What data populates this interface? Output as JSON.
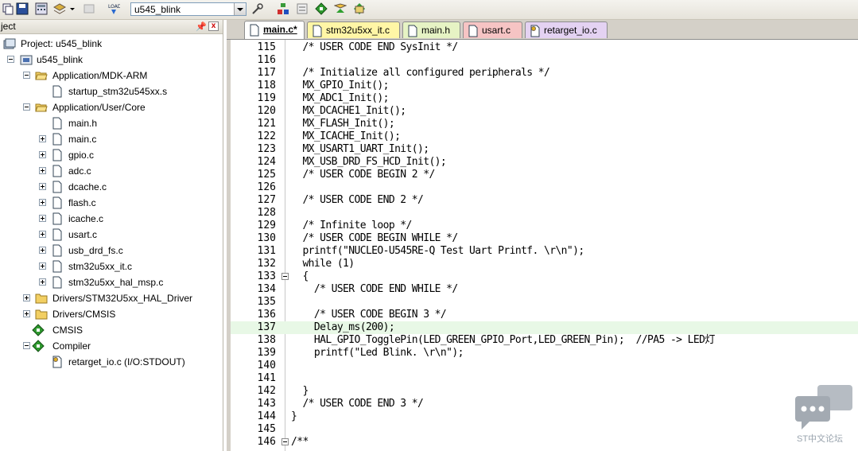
{
  "toolbar": {
    "target_select": {
      "value": "u545_blink"
    },
    "icons": [
      "copy-icon",
      "save-all-icon",
      "stack-icon",
      "dropdown-arrow-icon",
      "disabled-icon",
      "load-icon",
      "target-options-icon",
      "manage-components-icon",
      "window-icon",
      "pack-installer-icon",
      "select-pack-icon",
      "run-icon"
    ]
  },
  "project_panel": {
    "title": "ject",
    "tree": [
      {
        "label": "Project: u545_blink"
      },
      {
        "label": "u545_blink"
      },
      {
        "label": "Application/MDK-ARM"
      },
      {
        "label": "startup_stm32u545xx.s"
      },
      {
        "label": "Application/User/Core"
      },
      {
        "label": "main.h"
      },
      {
        "label": "main.c"
      },
      {
        "label": "gpio.c"
      },
      {
        "label": "adc.c"
      },
      {
        "label": "dcache.c"
      },
      {
        "label": "flash.c"
      },
      {
        "label": "icache.c"
      },
      {
        "label": "usart.c"
      },
      {
        "label": "usb_drd_fs.c"
      },
      {
        "label": "stm32u5xx_it.c"
      },
      {
        "label": "stm32u5xx_hal_msp.c"
      },
      {
        "label": "Drivers/STM32U5xx_HAL_Driver"
      },
      {
        "label": "Drivers/CMSIS"
      },
      {
        "label": "CMSIS"
      },
      {
        "label": "Compiler"
      },
      {
        "label": "retarget_io.c (I/O:STDOUT)"
      }
    ]
  },
  "editor": {
    "tabs": [
      {
        "label": "main.c*",
        "color": "#ffffff"
      },
      {
        "label": "stm32u5xx_it.c",
        "color": "#fff6a6"
      },
      {
        "label": "main.h",
        "color": "#e6f3c4"
      },
      {
        "label": "usart.c",
        "color": "#f6c4c4"
      },
      {
        "label": "retarget_io.c",
        "color": "#e4d2f2"
      }
    ],
    "lines": [
      {
        "num": "115",
        "code": "  /* USER CODE END SysInit */"
      },
      {
        "num": "116",
        "code": ""
      },
      {
        "num": "117",
        "code": "  /* Initialize all configured peripherals */"
      },
      {
        "num": "118",
        "code": "  MX_GPIO_Init();"
      },
      {
        "num": "119",
        "code": "  MX_ADC1_Init();"
      },
      {
        "num": "120",
        "code": "  MX_DCACHE1_Init();"
      },
      {
        "num": "121",
        "code": "  MX_FLASH_Init();"
      },
      {
        "num": "122",
        "code": "  MX_ICACHE_Init();"
      },
      {
        "num": "123",
        "code": "  MX_USART1_UART_Init();"
      },
      {
        "num": "124",
        "code": "  MX_USB_DRD_FS_HCD_Init();"
      },
      {
        "num": "125",
        "code": "  /* USER CODE BEGIN 2 */"
      },
      {
        "num": "126",
        "code": ""
      },
      {
        "num": "127",
        "code": "  /* USER CODE END 2 */"
      },
      {
        "num": "128",
        "code": ""
      },
      {
        "num": "129",
        "code": "  /* Infinite loop */"
      },
      {
        "num": "130",
        "code": "  /* USER CODE BEGIN WHILE */"
      },
      {
        "num": "131",
        "code": "  printf(\"NUCLEO-U545RE-Q Test Uart Printf. \\r\\n\");"
      },
      {
        "num": "132",
        "code": "  while (1)"
      },
      {
        "num": "133",
        "code": "  {"
      },
      {
        "num": "134",
        "code": "    /* USER CODE END WHILE */"
      },
      {
        "num": "135",
        "code": ""
      },
      {
        "num": "136",
        "code": "    /* USER CODE BEGIN 3 */"
      },
      {
        "num": "137",
        "code": "    Delay_ms(200);"
      },
      {
        "num": "138",
        "code": "    HAL_GPIO_TogglePin(LED_GREEN_GPIO_Port,LED_GREEN_Pin);  //PA5 -> LED灯"
      },
      {
        "num": "139",
        "code": "    printf(\"Led Blink. \\r\\n\");"
      },
      {
        "num": "140",
        "code": ""
      },
      {
        "num": "141",
        "code": ""
      },
      {
        "num": "142",
        "code": "  }"
      },
      {
        "num": "143",
        "code": "  /* USER CODE END 3 */"
      },
      {
        "num": "144",
        "code": "}"
      },
      {
        "num": "145",
        "code": ""
      },
      {
        "num": "146",
        "code": "/**"
      }
    ]
  },
  "watermark": {
    "text": "ST中文论坛"
  }
}
